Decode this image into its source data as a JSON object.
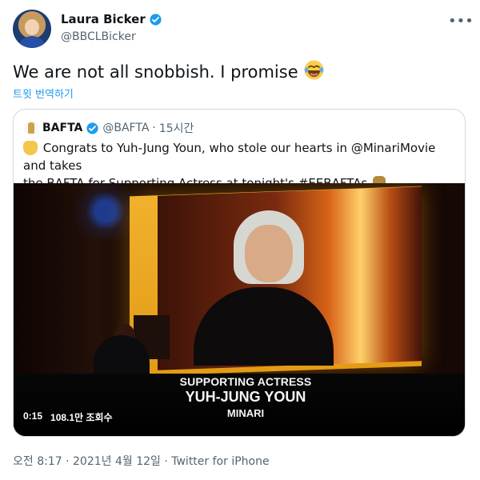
{
  "tweet": {
    "author_name": "Laura Bicker",
    "author_handle": "@BBCLBicker",
    "text": "We are not all snobbish. I promise",
    "translate_link": "트윗 번역하기",
    "footer": "오전 8:17 · 2021년 4월 12일 · Twitter for iPhone"
  },
  "quote": {
    "author_name": "BAFTA",
    "author_handle": "@BAFTA",
    "time": "15시간",
    "text_line1": "Congrats to Yuh-Jung Youn, who stole our hearts in @MinariMovie and takes",
    "text_line2": "the BAFTA for Supporting Actress at tonight's #EEBAFTAs",
    "video": {
      "caption_line1": "SUPPORTING ACTRESS",
      "caption_line2": "YUH-JUNG YOUN",
      "caption_line3": "MINARI",
      "duration": "0:15",
      "views": "108.1만 조회수"
    }
  },
  "colors": {
    "text_primary": "#0f1419",
    "text_secondary": "#536471",
    "link": "#1d9bf0",
    "verified": "#1d9bf0",
    "border": "#cfd9de"
  },
  "icons": {
    "verified": "verified-badge-icon",
    "more": "more-options-icon",
    "emoji": "tears-of-joy-emoji-icon"
  }
}
